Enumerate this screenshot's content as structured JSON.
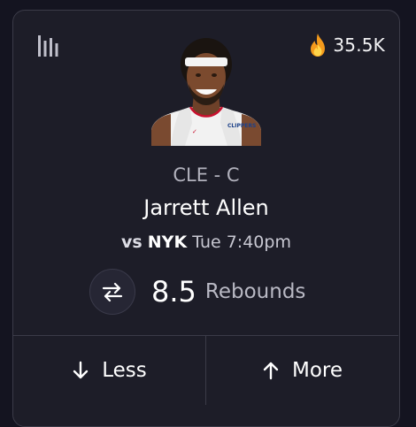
{
  "card": {
    "popularity": {
      "icon": "fire-icon",
      "count": "35.5K"
    },
    "stats_icon": "bar-chart-icon",
    "player": {
      "team_position": "CLE - C",
      "name": "Jarrett Allen",
      "jersey_text": "CLIPPERS"
    },
    "matchup": {
      "vs_label": "vs",
      "opponent": "NYK",
      "time": "Tue 7:40pm"
    },
    "projection": {
      "swap_icon": "swap-arrows-icon",
      "value": "8.5",
      "stat": "Rebounds"
    },
    "choices": {
      "less": {
        "label": "Less",
        "icon": "arrow-down-icon"
      },
      "more": {
        "label": "More",
        "icon": "arrow-up-icon"
      }
    }
  }
}
